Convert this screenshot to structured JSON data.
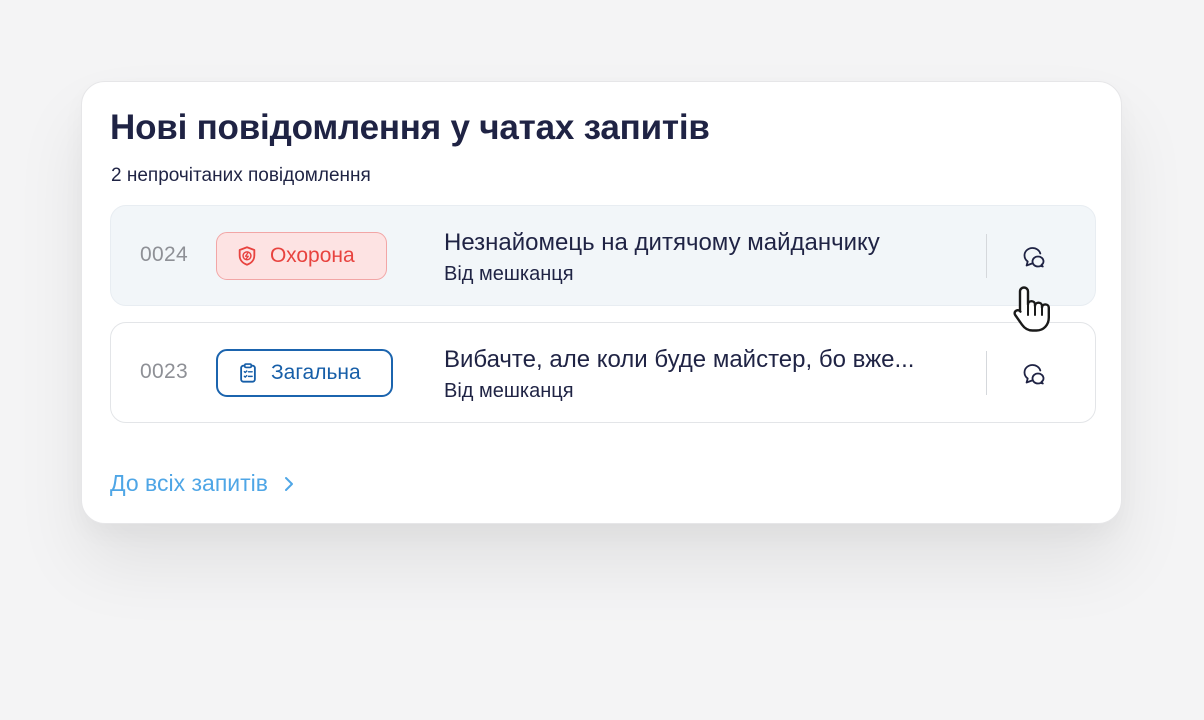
{
  "panel": {
    "title": "Нові повідомлення у чатах запитів",
    "subtitle": "2 непрочітаних повідомлення"
  },
  "requests": [
    {
      "id": "0024",
      "category": "Охорона",
      "category_icon": "shield-icon",
      "category_color": "#e8433f",
      "title": "Незнайомець на дитячому майданчику",
      "from": "Від мешканця",
      "chat_icon": "chat-bubbles-icon"
    },
    {
      "id": "0023",
      "category": "Загальна",
      "category_icon": "clipboard-list-icon",
      "category_color": "#165ea8",
      "title": "Вибачте, але коли буде майстер, бо вже...",
      "from": "Від мешканця",
      "chat_icon": "chat-bubbles-icon"
    }
  ],
  "footer": {
    "all_requests_link": "До всіх запитів",
    "link_icon": "chevron-right-icon",
    "link_color": "#4fa6e6"
  },
  "cursor": {
    "icon": "hand-pointer-icon"
  }
}
